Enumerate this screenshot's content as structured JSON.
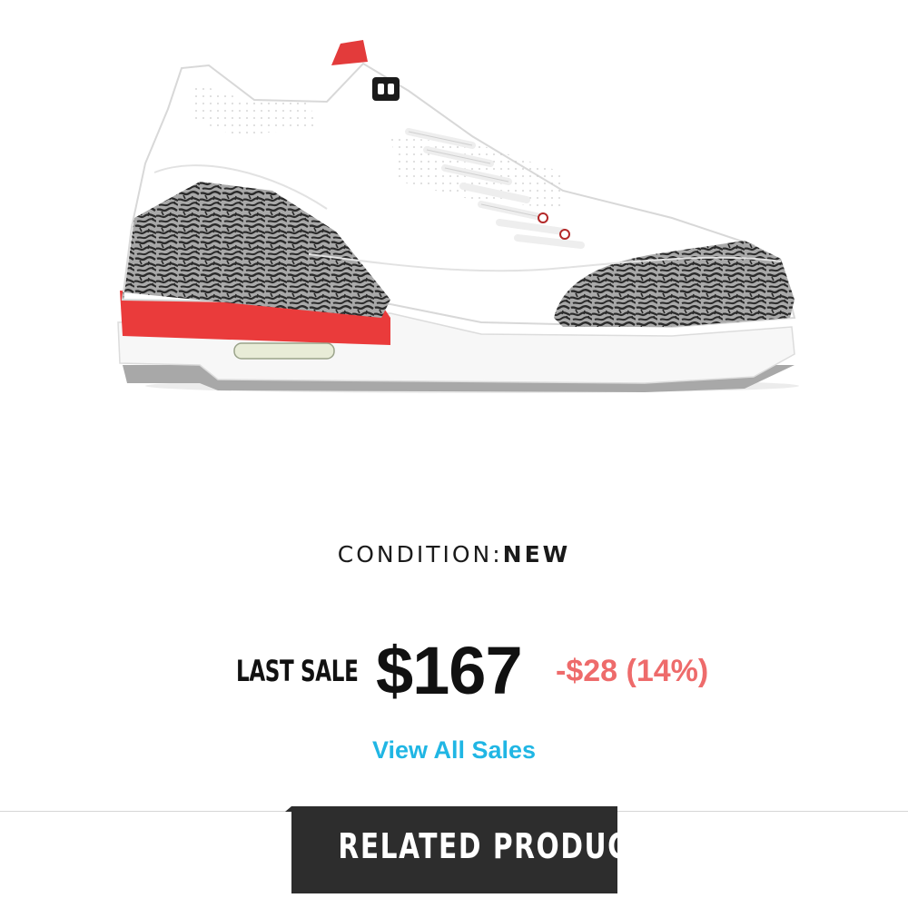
{
  "product": {
    "image_alt": "Air Jordan 3 sneaker",
    "condition_label": "CONDITION:",
    "condition_value": "NEW"
  },
  "last_sale": {
    "label": "LAST SALE",
    "price": "$167",
    "change": "-$28 (14%)"
  },
  "links": {
    "view_all_sales": "View All Sales"
  },
  "related": {
    "title": "RELATED PRODUCTS"
  },
  "colors": {
    "text_dark": "#111111",
    "change_red": "#ee6b6b",
    "link_blue": "#20b6e4",
    "tab_dark": "#2d2d2d",
    "sole_red": "#ea3b3b",
    "cement_grey": "#9a9a9a"
  }
}
